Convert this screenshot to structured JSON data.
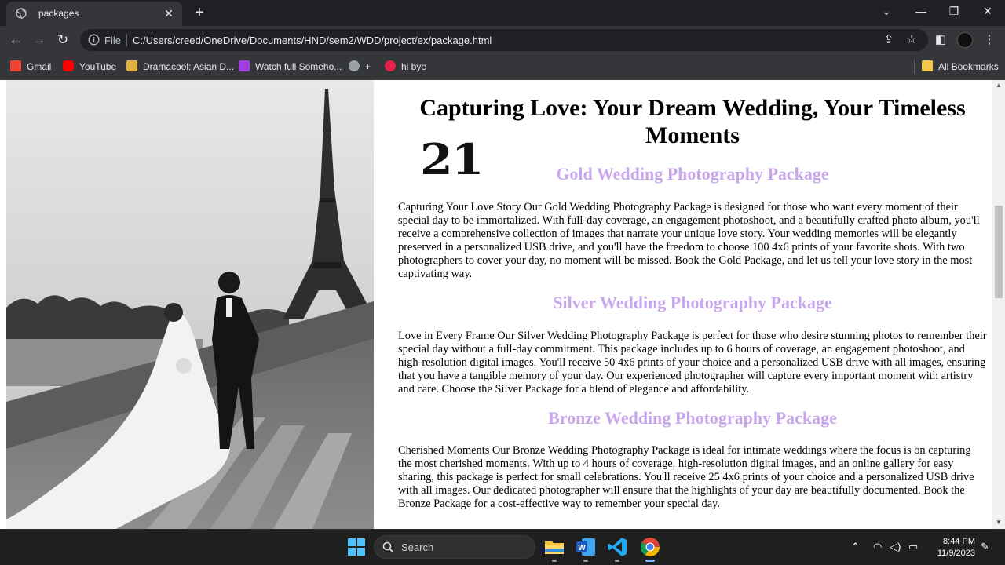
{
  "browser": {
    "tab_title": "packages",
    "tab_close": "✕",
    "new_tab": "+",
    "file_label": "File",
    "url": "C:/Users/creed/OneDrive/Documents/HND/sem2/WDD/project/ex/package.html",
    "bookmarks": [
      {
        "label": "Gmail",
        "icon": "gmail-icon",
        "color": "#ea4335"
      },
      {
        "label": "YouTube",
        "icon": "youtube-icon",
        "color": "#ff0000"
      },
      {
        "label": "Dramacool: Asian D...",
        "icon": "dramacool-icon",
        "color": "#e0b040"
      },
      {
        "label": "Watch full Someho...",
        "icon": "watch-icon",
        "color": "#a040e0"
      },
      {
        "label": "+",
        "icon": "globe-icon",
        "color": "#9aa0a6"
      },
      {
        "label": "hi bye",
        "icon": "m-icon",
        "color": "#e3234a"
      }
    ],
    "all_bookmarks": "All Bookmarks"
  },
  "page": {
    "heading": "Capturing Love: Your Dream Wedding, Your Timeless Moments",
    "number_graphic": "21",
    "packages": [
      {
        "title": "Gold Wedding Photography Package",
        "text": "Capturing Your Love Story Our Gold Wedding Photography Package is designed for those who want every moment of their special day to be immortalized. With full-day coverage, an engagement photoshoot, and a beautifully crafted photo album, you'll receive a comprehensive collection of images that narrate your unique love story. Your wedding memories will be elegantly preserved in a personalized USB drive, and you'll have the freedom to choose 100 4x6 prints of your favorite shots. With two photographers to cover your day, no moment will be missed. Book the Gold Package, and let us tell your love story in the most captivating way."
      },
      {
        "title": "Silver Wedding Photography Package",
        "text": "Love in Every Frame Our Silver Wedding Photography Package is perfect for those who desire stunning photos to remember their special day without a full-day commitment. This package includes up to 6 hours of coverage, an engagement photoshoot, and high-resolution digital images. You'll receive 50 4x6 prints of your choice and a personalized USB drive with all images, ensuring that you have a tangible memory of your day. Our experienced photographer will capture every important moment with artistry and care. Choose the Silver Package for a blend of elegance and affordability."
      },
      {
        "title": "Bronze Wedding Photography Package",
        "text": "Cherished Moments Our Bronze Wedding Photography Package is ideal for intimate weddings where the focus is on capturing the most cherished moments. With up to 4 hours of coverage, high-resolution digital images, and an online gallery for easy sharing, this package is perfect for small celebrations. You'll receive 25 4x6 prints of your choice and a personalized USB drive with all images. Our dedicated photographer will ensure that the highlights of your day are beautifully documented. Book the Bronze Package for a cost-effective way to remember your special day."
      }
    ],
    "heading_color": "#c8a6ec"
  },
  "taskbar": {
    "search_label": "Search",
    "time": "8:44 PM",
    "date": "11/9/2023"
  }
}
